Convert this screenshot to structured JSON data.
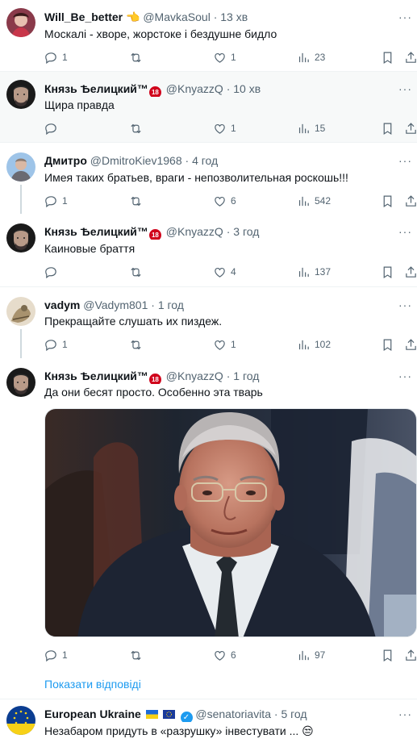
{
  "tweets": [
    {
      "name": "Will_Be_better",
      "name_suffix": "👈",
      "handle": "@MavkaSoul",
      "time": "13 хв",
      "text": "Москалі - хворе, жорстоке і бездушне бидло",
      "reply_count": "1",
      "retweet_count": "",
      "like_count": "1",
      "view_count": "23"
    },
    {
      "name": "Князь Ѣелицкий™",
      "badge": "18",
      "handle": "@KnyazzQ",
      "time": "10 хв",
      "text": "Щира правда",
      "reply_count": "",
      "retweet_count": "",
      "like_count": "1",
      "view_count": "15"
    },
    {
      "name": "Дмитро",
      "handle": "@DmitroKiev1968",
      "time": "4 год",
      "text": "Имея таких братьев, враги - непозволительная роскошь!!!",
      "reply_count": "1",
      "retweet_count": "",
      "like_count": "6",
      "view_count": "542"
    },
    {
      "name": "Князь Ѣелицкий™",
      "badge": "18",
      "handle": "@KnyazzQ",
      "time": "3 год",
      "text": "Каиновые браття",
      "reply_count": "",
      "retweet_count": "",
      "like_count": "4",
      "view_count": "137"
    },
    {
      "name": "vadym",
      "handle": "@Vadym801",
      "time": "1 год",
      "text": "Прекращайте слушать их пиздеж.",
      "reply_count": "1",
      "retweet_count": "",
      "like_count": "1",
      "view_count": "102"
    },
    {
      "name": "Князь Ѣелицкий™",
      "badge": "18",
      "handle": "@KnyazzQ",
      "time": "1 год",
      "text": "Да они бесят просто. Особенно эта тварь",
      "reply_count": "1",
      "retweet_count": "",
      "like_count": "6",
      "view_count": "97"
    },
    {
      "name": "European Ukraine",
      "handle": "@senatoriavita",
      "time": "5 год",
      "text": "Незабаром придуть в «разрушку» інвестувати ... 😒"
    }
  ],
  "show_replies": "Показати відповіді",
  "separator": "·",
  "more_label": "···",
  "colors": {
    "accent": "#1d9bf0",
    "muted": "#536471",
    "highlight_bg": "#f7f9f9",
    "badge_red": "#d0021b"
  },
  "icons": [
    "reply-icon",
    "retweet-icon",
    "like-icon",
    "views-icon",
    "bookmark-icon",
    "share-icon",
    "verified-icon",
    "flag-ukraine-icon",
    "flag-eu-icon"
  ]
}
